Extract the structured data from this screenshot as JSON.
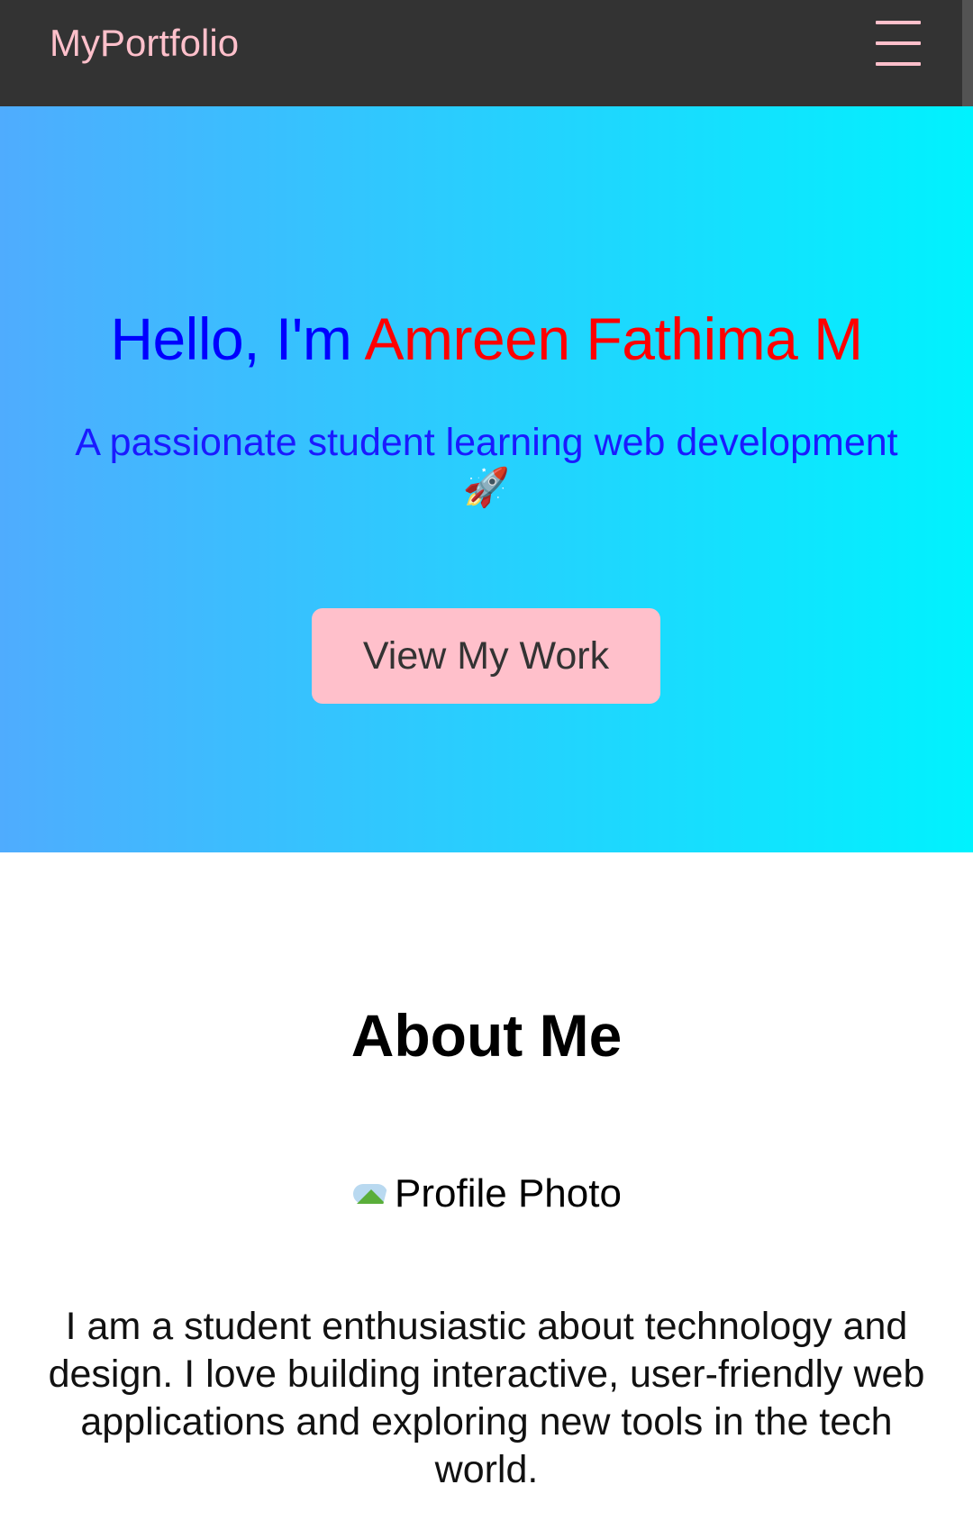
{
  "navbar": {
    "brand": "MyPortfolio",
    "menu_icon": "hamburger-menu-icon"
  },
  "hero": {
    "greeting": "Hello, I'm ",
    "name": "Amreen Fathima M",
    "subtitle": "A passionate student learning web development",
    "subtitle_icon": "rocket-icon",
    "subtitle_emoji": "🚀",
    "cta_label": "View My Work",
    "gradient_start": "#4facfe",
    "gradient_end": "#00f2fe",
    "greeting_color": "#0000ff",
    "name_color": "#ff0000"
  },
  "about": {
    "title": "About Me",
    "profile_alt": "Profile Photo",
    "profile_icon": "broken-image-icon",
    "text": "I am a student enthusiastic about technology and design. I love building interactive, user-friendly web applications and exploring new tools in the tech world."
  },
  "colors": {
    "navbar_bg": "#333333",
    "accent_pink": "#ffc0cb"
  }
}
